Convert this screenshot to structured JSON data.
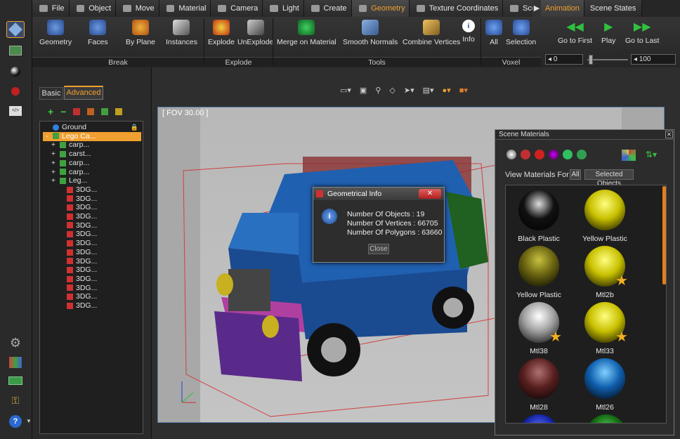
{
  "app": {
    "accent": "#f0a030"
  },
  "tabs": [
    {
      "label": "File",
      "icon": "file-icon"
    },
    {
      "label": "Object",
      "icon": "object-icon"
    },
    {
      "label": "Move",
      "icon": "move-icon"
    },
    {
      "label": "Material",
      "icon": "material-icon"
    },
    {
      "label": "Camera",
      "icon": "camera-icon"
    },
    {
      "label": "Light",
      "icon": "light-icon"
    },
    {
      "label": "Create",
      "icon": "create-icon"
    },
    {
      "label": "Geometry",
      "icon": "geometry-icon",
      "active": true
    },
    {
      "label": "Texture Coordinates",
      "icon": "texture-icon"
    },
    {
      "label": "Sce",
      "icon": "scene-icon"
    }
  ],
  "ribbon": {
    "buttons": [
      "Geometry",
      "Faces",
      "By Plane",
      "Instances",
      "Explode",
      "UnExplode",
      "Merge on Material",
      "Smooth Normals",
      "Combine Vertices",
      "Info",
      "All",
      "Selection"
    ],
    "groups": [
      "Break",
      "Explode",
      "Tools",
      "Voxel"
    ]
  },
  "anim": {
    "tabs": [
      "Animation",
      "Scene States"
    ],
    "buttons": [
      "Go to First",
      "Play",
      "Go to Last"
    ],
    "start_value": "0",
    "end_value": "100"
  },
  "side": {
    "tabs": [
      "Basic",
      "Advanced"
    ],
    "tree": [
      {
        "label": "Ground",
        "expander": ""
      },
      {
        "label": "Lego Ca...",
        "expander": "-"
      },
      {
        "label": "carp...",
        "expander": "+"
      },
      {
        "label": "carst...",
        "expander": "+"
      },
      {
        "label": "carp...",
        "expander": "+"
      },
      {
        "label": "carp...",
        "expander": "+"
      },
      {
        "label": "Leg...",
        "expander": "+"
      },
      {
        "label": "3DG...",
        "expander": ""
      },
      {
        "label": "3DG...",
        "expander": ""
      },
      {
        "label": "3DG...",
        "expander": ""
      },
      {
        "label": "3DG...",
        "expander": ""
      },
      {
        "label": "3DG...",
        "expander": ""
      },
      {
        "label": "3DG...",
        "expander": ""
      },
      {
        "label": "3DG...",
        "expander": ""
      },
      {
        "label": "3DG...",
        "expander": ""
      },
      {
        "label": "3DG...",
        "expander": ""
      },
      {
        "label": "3DG...",
        "expander": ""
      },
      {
        "label": "3DG...",
        "expander": ""
      },
      {
        "label": "3DG...",
        "expander": ""
      },
      {
        "label": "3DG...",
        "expander": ""
      },
      {
        "label": "3DG...",
        "expander": ""
      }
    ]
  },
  "viewport": {
    "fov_label": "[ FOV 30.00 ]"
  },
  "scene_materials": {
    "title": "Scene Materials",
    "view_for": "View Materials For:",
    "filter_all": "All",
    "filter_selected": "Selected Objects",
    "materials": [
      {
        "name": "Black Plastic",
        "color": "#111111",
        "hi": "#dddddd",
        "star": false
      },
      {
        "name": "Yellow Plastic",
        "color": "#c8c000",
        "hi": "#ffff80",
        "star": false
      },
      {
        "name": "Yellow Plastic",
        "color": "#6a6410",
        "hi": "#c8c040",
        "star": false
      },
      {
        "name": "Mtl2b",
        "color": "#c8c000",
        "hi": "#ffff80",
        "star": true
      },
      {
        "name": "Mtl38",
        "color": "#a0a0a0",
        "hi": "#ffffff",
        "star": true
      },
      {
        "name": "Mtl33",
        "color": "#c8c000",
        "hi": "#ffff80",
        "star": true
      },
      {
        "name": "Mtl28",
        "color": "#5a2020",
        "hi": "#b07070",
        "star": false
      },
      {
        "name": "Mtl26",
        "color": "#1060b0",
        "hi": "#80d0ff",
        "star": false
      }
    ]
  },
  "dialog": {
    "title": "Geometrical Info",
    "lines": [
      "Number Of Objects : 19",
      "Number Of Vertices : 66705",
      "Number Of Polygons : 63660"
    ],
    "close_label": "Close"
  }
}
